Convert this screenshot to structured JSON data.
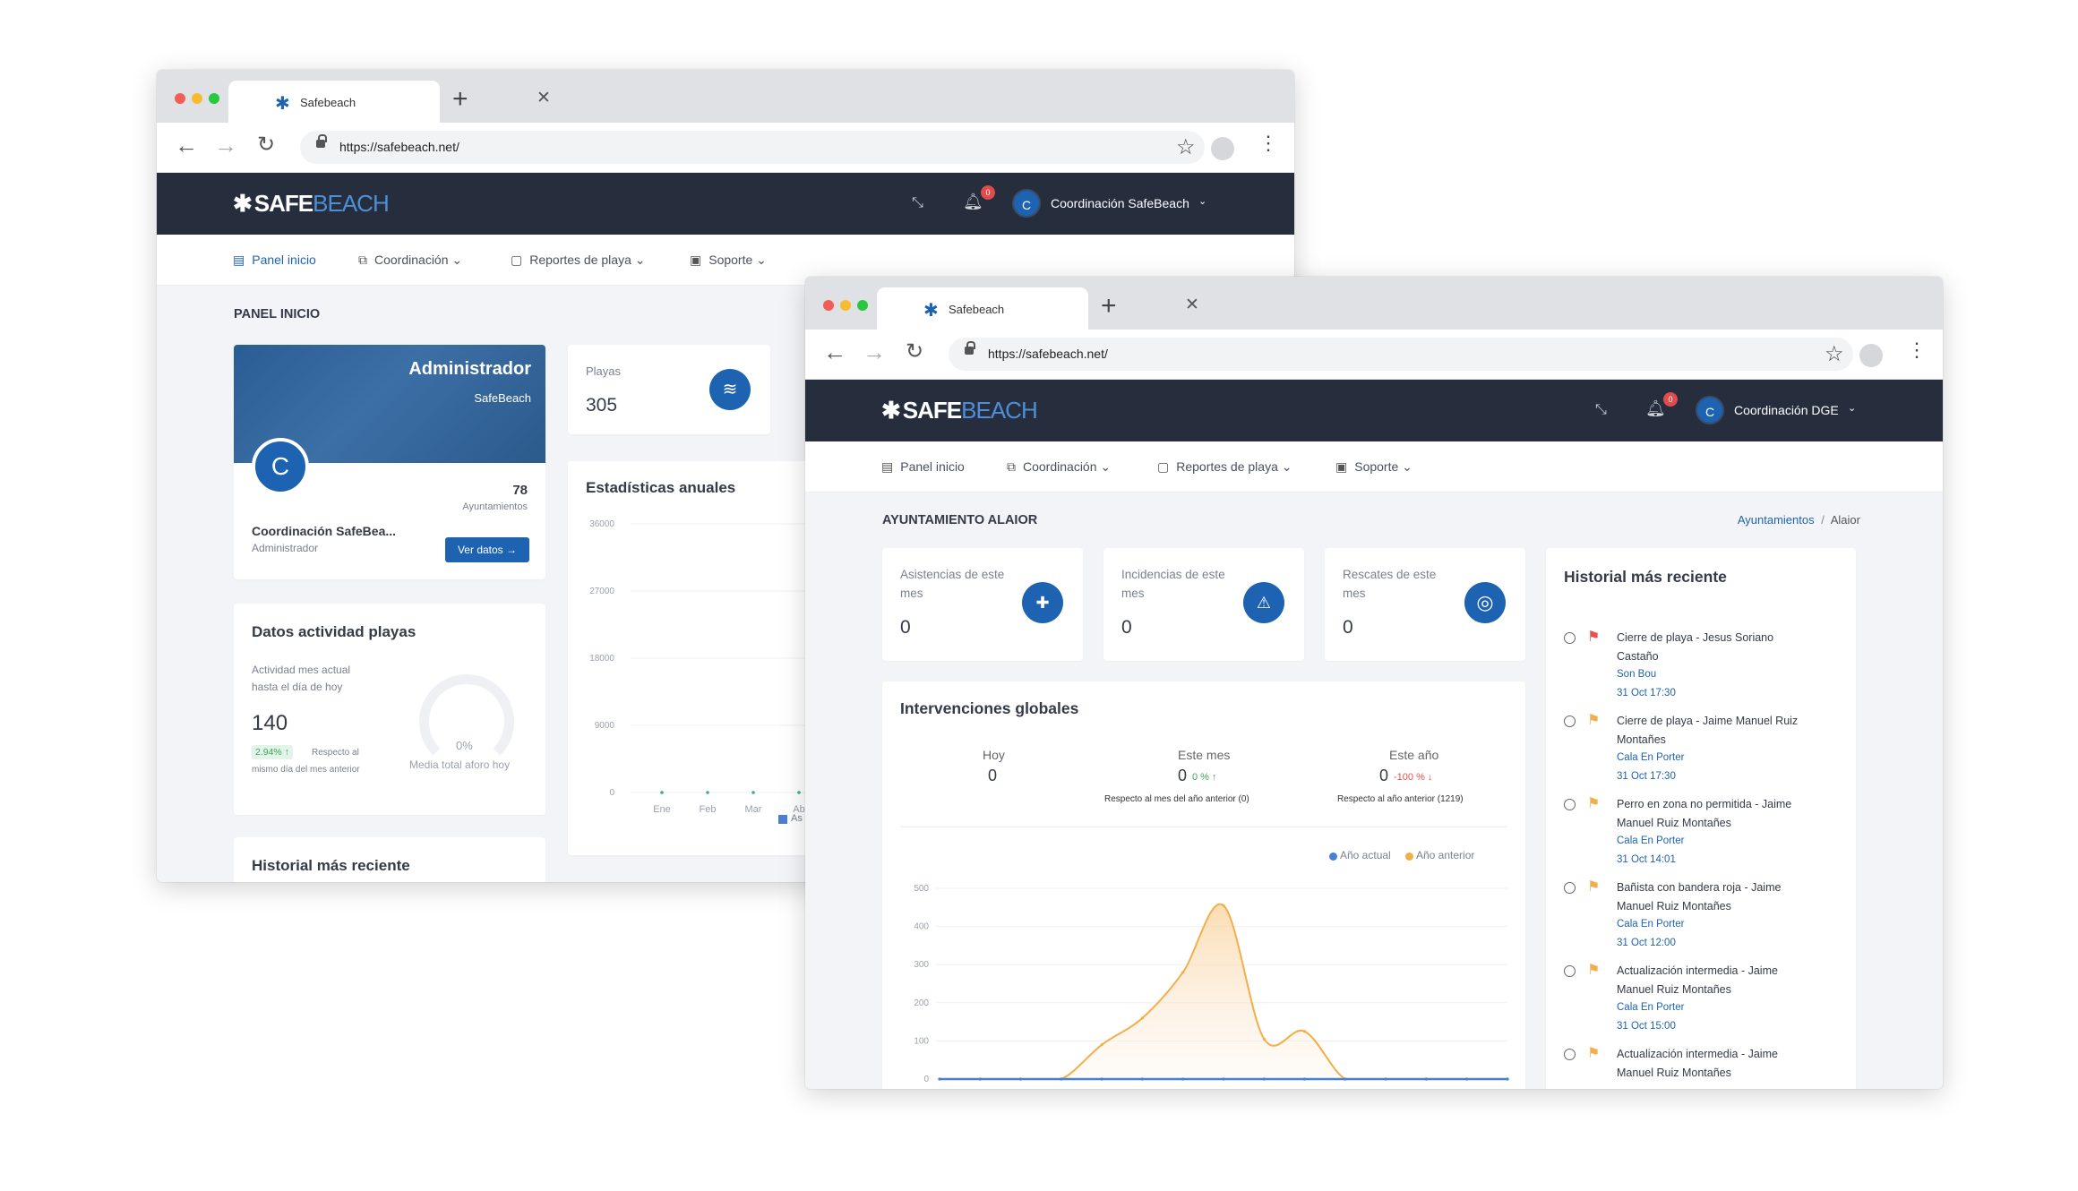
{
  "back_window": {
    "tab_title": "Safebeach",
    "url": "https://safebeach.net/",
    "brand": {
      "part1": "SAFE",
      "part2": "BEACH"
    },
    "notification_count": "0",
    "user": {
      "initial": "C",
      "name": "Coordinación SafeBeach"
    },
    "menu": [
      {
        "label": "Panel inicio"
      },
      {
        "label": "Coordinación"
      },
      {
        "label": "Reportes de playa"
      },
      {
        "label": "Soporte"
      }
    ],
    "page_title": "PANEL INICIO",
    "profile_card": {
      "role_title": "Administrador",
      "org": "SafeBeach",
      "initial": "C",
      "count": "78",
      "count_label": "Ayuntamientos",
      "name": "Coordinación SafeBea...",
      "role": "Administrador",
      "button": "Ver datos"
    },
    "playas_card": {
      "label": "Playas",
      "value": "305"
    },
    "activity_card": {
      "title": "Datos actividad playas",
      "desc_line1": "Actividad mes actual",
      "desc_line2": "hasta el día de hoy",
      "value": "140",
      "pct": "2.94% ↑",
      "pct_note_line1": "Respecto al",
      "pct_note_line2": "mismo día del mes anterior",
      "gauge_value": "0%",
      "gauge_label": "Media total aforo hoy"
    },
    "history_title": "Historial más reciente",
    "annual_stats": {
      "title": "Estadísticas anuales",
      "legend_partial": "As"
    }
  },
  "front_window": {
    "tab_title": "Safebeach",
    "url": "https://safebeach.net/",
    "brand": {
      "part1": "SAFE",
      "part2": "BEACH"
    },
    "notification_count": "0",
    "user": {
      "initial": "C",
      "name": "Coordinación DGE"
    },
    "menu": [
      {
        "label": "Panel inicio"
      },
      {
        "label": "Coordinación"
      },
      {
        "label": "Reportes de playa"
      },
      {
        "label": "Soporte"
      }
    ],
    "page_title": "AYUNTAMIENTO ALAIOR",
    "breadcrumb": {
      "link": "Ayuntamientos",
      "sep": "/",
      "current": "Alaior"
    },
    "stat_cards": [
      {
        "label_line1": "Asistencias de este",
        "label_line2": "mes",
        "value": "0",
        "icon": "medkit-icon"
      },
      {
        "label_line1": "Incidencias de este",
        "label_line2": "mes",
        "value": "0",
        "icon": "warning-icon"
      },
      {
        "label_line1": "Rescates de este",
        "label_line2": "mes",
        "value": "0",
        "icon": "lifebuoy-icon"
      }
    ],
    "interventions": {
      "title": "Intervenciones globales",
      "today_label": "Hoy",
      "today_value": "0",
      "month_label": "Este mes",
      "month_value": "0",
      "month_pct": "0 % ↑",
      "month_note": "Respecto al mes del año anterior (0)",
      "year_label": "Este año",
      "year_value": "0",
      "year_pct": "-100 % ↓",
      "year_note": "Respecto al año anterior (1219)",
      "legend_current": "Año actual",
      "legend_previous": "Año anterior"
    },
    "history": {
      "title": "Historial más reciente",
      "items": [
        {
          "text": "Cierre de playa - Jesus Soriano Castaño",
          "place": "Son Bou",
          "date": "31 Oct 17:30",
          "flag": "red"
        },
        {
          "text": "Cierre de playa - Jaime Manuel Ruiz Montañes",
          "place": "Cala En Porter",
          "date": "31 Oct 17:30",
          "flag": "orange"
        },
        {
          "text": "Perro en zona no permitida - Jaime Manuel Ruiz Montañes",
          "place": "Cala En Porter",
          "date": "31 Oct 14:01",
          "flag": "orange"
        },
        {
          "text": "Bañista con bandera roja - Jaime Manuel Ruiz Montañes",
          "place": "Cala En Porter",
          "date": "31 Oct 12:00",
          "flag": "orange"
        },
        {
          "text": "Actualización intermedia - Jaime Manuel Ruiz Montañes",
          "place": "Cala En Porter",
          "date": "31 Oct 15:00",
          "flag": "orange"
        },
        {
          "text": "Actualización intermedia - Jaime Manuel Ruiz Montañes",
          "place": "",
          "date": "",
          "flag": "orange"
        }
      ]
    }
  },
  "colors": {
    "primary": "#1d63b2",
    "navbar": "#262e3e",
    "current_year": "#4a7fd4",
    "previous_year": "#f2ae4a",
    "flag_red": "#e6524a",
    "flag_orange": "#f2ae4a"
  },
  "chart_data": [
    {
      "type": "line",
      "title": "Estadísticas anuales",
      "categories": [
        "Ene",
        "Feb",
        "Mar",
        "Ab"
      ],
      "yticks": [
        0,
        9000,
        18000,
        27000,
        36000
      ],
      "ylim": [
        0,
        36000
      ],
      "series": [
        {
          "name": "As",
          "values": [
            0,
            0,
            0,
            0
          ]
        }
      ]
    },
    {
      "type": "area",
      "title": "Intervenciones globales",
      "yticks": [
        0,
        100,
        200,
        300,
        400,
        500
      ],
      "ylim": [
        0,
        500
      ],
      "x": [
        0,
        1,
        2,
        3,
        4,
        5,
        6,
        7,
        8,
        9,
        10,
        11,
        12,
        13,
        14
      ],
      "series": [
        {
          "name": "Año actual",
          "values": [
            0,
            0,
            0,
            0,
            0,
            0,
            0,
            0,
            0,
            0,
            0,
            0,
            0,
            0,
            0
          ]
        },
        {
          "name": "Año anterior",
          "values": [
            0,
            0,
            0,
            0,
            90,
            160,
            280,
            455,
            105,
            125,
            0,
            0,
            0,
            0,
            0
          ]
        }
      ],
      "legend": "top-right"
    }
  ]
}
